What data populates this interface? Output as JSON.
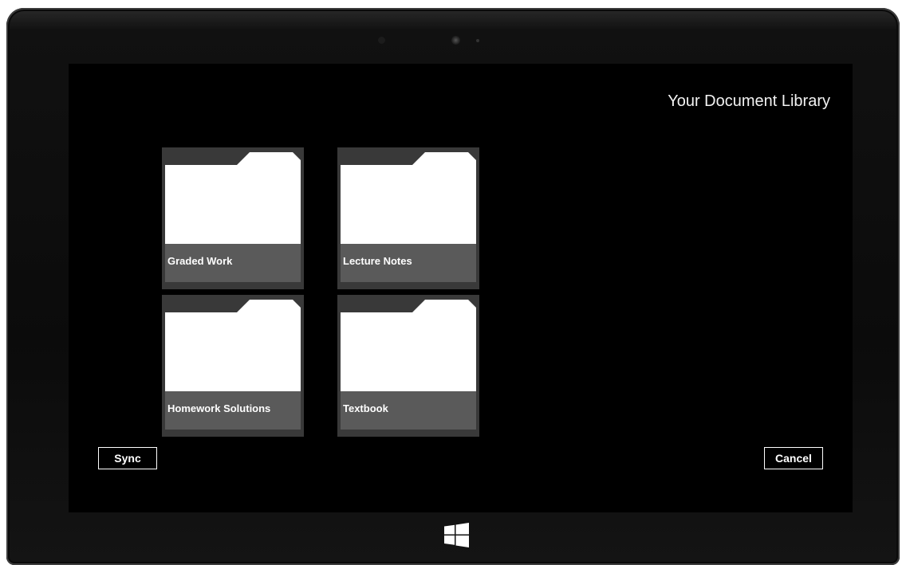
{
  "screen": {
    "title": "Your Document Library"
  },
  "folders": [
    {
      "label": "Graded Work"
    },
    {
      "label": "Lecture Notes"
    },
    {
      "label": "Homework Solutions"
    },
    {
      "label": "Textbook"
    }
  ],
  "actions": {
    "sync_label": "Sync",
    "cancel_label": "Cancel"
  },
  "icons": {
    "folder": "folder-icon",
    "windows": "windows-logo-icon"
  },
  "colors": {
    "background": "#000000",
    "tile": "#393939",
    "tile_label": "#5a5a5a",
    "folder": "#ffffff",
    "text": "#ffffff"
  }
}
